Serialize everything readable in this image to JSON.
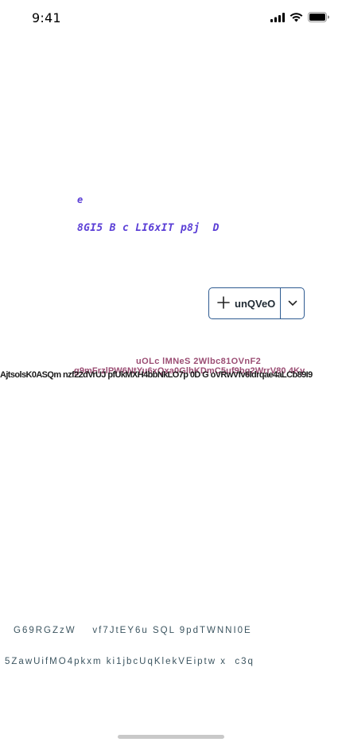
{
  "status_bar": {
    "time": "9:41",
    "icons": [
      "cellular-signal-icon",
      "wifi-icon",
      "battery-icon"
    ]
  },
  "mono_block": {
    "line1": "e",
    "line2": "8GI5 B c LI6xIT p8j  D",
    "color": "#5b3fd6"
  },
  "split_button": {
    "label": "unQVeO",
    "plus_icon": "plus-icon",
    "caret_icon": "chevron-down-icon",
    "border_color": "#2e5b91"
  },
  "overlap_text": {
    "pink_title": "uOLc lMNeS 2Wlbc81OVnF2",
    "pink_sub": "g9mFrzlPW6NtYu6xQxa0GlhKDmC5uf9bg2WrrV80 4Ky",
    "black_line": "AjtsolsK0ASQm nzf22dVrUJ pfUkMXH4bbNkLO7p 0D G oVRwVfv6ldrqae4aLCb89I9",
    "pink_color": "#9b4d73"
  },
  "teal_block": {
    "line1": "G69RGZzW    vf7JtEY6u SQL 9pdTWNNI0E",
    "line2": "5ZawUifMO4pkxm ki1jbcUqKlekVEiptw x  c3q",
    "color": "#3c5560"
  }
}
